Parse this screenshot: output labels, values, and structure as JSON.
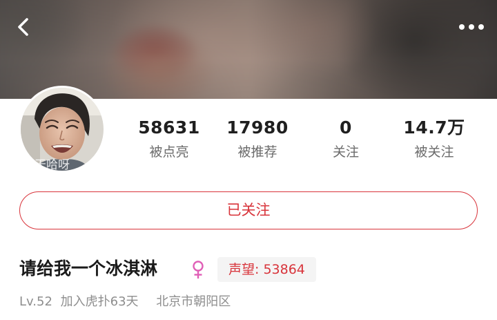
{
  "header": {
    "back_icon": "chevron-left-icon",
    "more_icon": "more-horizontal-icon"
  },
  "profile": {
    "avatar_caption": "天哈呀",
    "stats": [
      {
        "value": "58631",
        "label": "被点亮"
      },
      {
        "value": "17980",
        "label": "被推荐"
      },
      {
        "value": "0",
        "label": "关注"
      },
      {
        "value": "14.7万",
        "label": "被关注"
      }
    ],
    "follow_button_label": "已关注",
    "name": "请给我一个冰淇淋",
    "gender_icon": "female-symbol-icon",
    "reputation_label": "声望: 53864",
    "level": "Lv.52",
    "joined": "加入虎扑63天",
    "location": "北京市朝阳区"
  },
  "colors": {
    "accent": "#d8333a",
    "gender": "#e05fb7",
    "secondary_text": "#8e8e8e"
  }
}
